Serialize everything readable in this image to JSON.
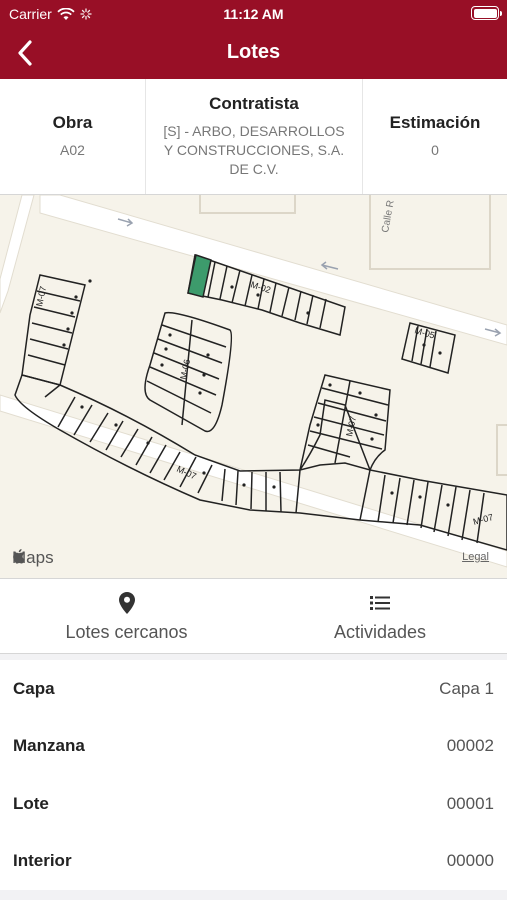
{
  "status_bar": {
    "carrier": "Carrier",
    "time": "11:12 AM"
  },
  "nav": {
    "title": "Lotes",
    "back_icon": "chevron-left-icon"
  },
  "info": {
    "obra": {
      "label": "Obra",
      "value": "A02"
    },
    "contratista": {
      "label": "Contratista",
      "value": "[S] - ARBO, DESARROLLOS Y CONSTRUCCIONES, S.A. DE C.V."
    },
    "estimacion": {
      "label": "Estimación",
      "value": "0"
    }
  },
  "map": {
    "attribution": "Maps",
    "legal": "Legal",
    "street_label": "Calle R",
    "block_labels": [
      "M-02",
      "M-07",
      "M-06",
      "M-05",
      "M-07",
      "M-07",
      "M-07"
    ],
    "selected_lot_color": "#3d9b6c"
  },
  "tabs": [
    {
      "label": "Lotes cercanos",
      "icon": "location-pin-icon"
    },
    {
      "label": "Actividades",
      "icon": "list-icon"
    }
  ],
  "details": [
    {
      "key": "Capa",
      "value": "Capa 1"
    },
    {
      "key": "Manzana",
      "value": "00002"
    },
    {
      "key": "Lote",
      "value": "00001"
    },
    {
      "key": "Interior",
      "value": "00000"
    }
  ],
  "colors": {
    "brand": "#980f26",
    "map_bg": "#f6f3ea"
  }
}
